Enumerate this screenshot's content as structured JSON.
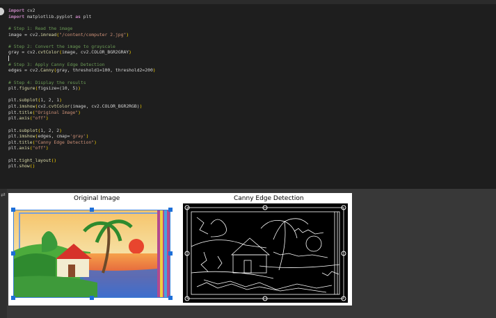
{
  "notebook": {
    "code_lines": [
      {
        "parts": [
          {
            "t": "import",
            "c": "kw"
          },
          {
            "t": " cv2",
            "c": ""
          }
        ]
      },
      {
        "parts": [
          {
            "t": "import",
            "c": "kw"
          },
          {
            "t": " matplotlib.pyplot ",
            "c": ""
          },
          {
            "t": "as",
            "c": "kw"
          },
          {
            "t": " plt",
            "c": ""
          }
        ]
      },
      {
        "parts": []
      },
      {
        "parts": [
          {
            "t": "# Step 1: Read the image",
            "c": "cm"
          }
        ]
      },
      {
        "parts": [
          {
            "t": "image = cv2.",
            "c": ""
          },
          {
            "t": "imread",
            "c": "fn"
          },
          {
            "t": "(",
            "c": "paren"
          },
          {
            "t": "\"/content/computer 2.jpg\"",
            "c": "st"
          },
          {
            "t": ")",
            "c": "paren"
          }
        ]
      },
      {
        "parts": []
      },
      {
        "parts": [
          {
            "t": "# Step 2: Convert the image to grayscale",
            "c": "cm"
          }
        ]
      },
      {
        "parts": [
          {
            "t": "gray = cv2.",
            "c": ""
          },
          {
            "t": "cvtColor",
            "c": "fn"
          },
          {
            "t": "(",
            "c": "paren"
          },
          {
            "t": "image, cv2.COLOR_BGR2GRAY",
            "c": ""
          },
          {
            "t": ")",
            "c": "paren"
          }
        ]
      },
      {
        "parts": [
          {
            "t": "",
            "c": "cursor"
          }
        ]
      },
      {
        "parts": [
          {
            "t": "# Step 3: Apply Canny Edge Detection",
            "c": "cm"
          }
        ]
      },
      {
        "parts": [
          {
            "t": "edges = cv2.",
            "c": ""
          },
          {
            "t": "Canny",
            "c": "fn"
          },
          {
            "t": "(",
            "c": "paren"
          },
          {
            "t": "gray, threshold1=100, threshold2=200",
            "c": ""
          },
          {
            "t": ")",
            "c": "paren"
          }
        ]
      },
      {
        "parts": []
      },
      {
        "parts": [
          {
            "t": "# Step 4: Display the results",
            "c": "cm"
          }
        ]
      },
      {
        "parts": [
          {
            "t": "plt.",
            "c": ""
          },
          {
            "t": "figure",
            "c": "fn"
          },
          {
            "t": "(",
            "c": "paren"
          },
          {
            "t": "figsize=(10, 5)",
            "c": ""
          },
          {
            "t": ")",
            "c": "paren"
          }
        ]
      },
      {
        "parts": []
      },
      {
        "parts": [
          {
            "t": "plt.",
            "c": ""
          },
          {
            "t": "subplot",
            "c": "fn"
          },
          {
            "t": "(",
            "c": "paren"
          },
          {
            "t": "1, 2, 1",
            "c": ""
          },
          {
            "t": ")",
            "c": "paren"
          }
        ]
      },
      {
        "parts": [
          {
            "t": "plt.",
            "c": ""
          },
          {
            "t": "imshow",
            "c": "fn"
          },
          {
            "t": "(",
            "c": "paren"
          },
          {
            "t": "cv2.",
            "c": ""
          },
          {
            "t": "cvtColor",
            "c": "fn"
          },
          {
            "t": "(image, cv2.COLOR_BGR2RGB)",
            "c": ""
          },
          {
            "t": ")",
            "c": "paren"
          }
        ]
      },
      {
        "parts": [
          {
            "t": "plt.",
            "c": ""
          },
          {
            "t": "title",
            "c": "fn"
          },
          {
            "t": "(",
            "c": "paren"
          },
          {
            "t": "\"Original Image\"",
            "c": "st"
          },
          {
            "t": ")",
            "c": "paren"
          }
        ]
      },
      {
        "parts": [
          {
            "t": "plt.",
            "c": ""
          },
          {
            "t": "axis",
            "c": "fn"
          },
          {
            "t": "(",
            "c": "paren"
          },
          {
            "t": "\"off\"",
            "c": "st"
          },
          {
            "t": ")",
            "c": "paren"
          }
        ]
      },
      {
        "parts": []
      },
      {
        "parts": [
          {
            "t": "plt.",
            "c": ""
          },
          {
            "t": "subplot",
            "c": "fn"
          },
          {
            "t": "(",
            "c": "paren"
          },
          {
            "t": "1, 2, 2",
            "c": ""
          },
          {
            "t": ")",
            "c": "paren"
          }
        ]
      },
      {
        "parts": [
          {
            "t": "plt.",
            "c": ""
          },
          {
            "t": "imshow",
            "c": "fn"
          },
          {
            "t": "(",
            "c": "paren"
          },
          {
            "t": "edges, cmap=",
            "c": ""
          },
          {
            "t": "'gray'",
            "c": "st"
          },
          {
            "t": ")",
            "c": "paren"
          }
        ]
      },
      {
        "parts": [
          {
            "t": "plt.",
            "c": ""
          },
          {
            "t": "title",
            "c": "fn"
          },
          {
            "t": "(",
            "c": "paren"
          },
          {
            "t": "\"Canny Edge Detection\"",
            "c": "st"
          },
          {
            "t": ")",
            "c": "paren"
          }
        ]
      },
      {
        "parts": [
          {
            "t": "plt.",
            "c": ""
          },
          {
            "t": "axis",
            "c": "fn"
          },
          {
            "t": "(",
            "c": "paren"
          },
          {
            "t": "\"off\"",
            "c": "st"
          },
          {
            "t": ")",
            "c": "paren"
          }
        ]
      },
      {
        "parts": []
      },
      {
        "parts": [
          {
            "t": "plt.",
            "c": ""
          },
          {
            "t": "tight_layout",
            "c": "fn"
          },
          {
            "t": "()",
            "c": "paren"
          }
        ]
      },
      {
        "parts": [
          {
            "t": "plt.",
            "c": ""
          },
          {
            "t": "show",
            "c": "fn"
          },
          {
            "t": "()",
            "c": "paren"
          }
        ]
      }
    ]
  },
  "output": {
    "icon": "output-toggle-icon",
    "icon_glyph": "⇄",
    "left_title": "Original Image",
    "right_title": "Canny Edge Detection"
  },
  "colors": {
    "cell_bg": "#1e1e1e",
    "output_bg": "#383838",
    "selection_handle": "#1d6fd8"
  }
}
